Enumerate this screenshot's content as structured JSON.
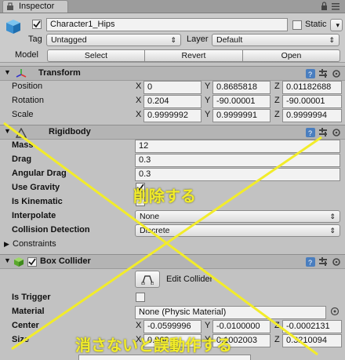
{
  "window": {
    "tab_label": "Inspector"
  },
  "header": {
    "object_name": "Character1_Hips",
    "static_label": "Static",
    "tag_label": "Tag",
    "tag_value": "Untagged",
    "layer_label": "Layer",
    "layer_value": "Default",
    "model_label": "Model",
    "model_buttons": [
      "Select",
      "Revert",
      "Open"
    ]
  },
  "transform": {
    "title": "Transform",
    "rows": [
      {
        "label": "Position",
        "x": "0",
        "y": "0.8685818",
        "z": "0.01182688"
      },
      {
        "label": "Rotation",
        "x": "0.204",
        "y": "-90.00001",
        "z": "-90.00001"
      },
      {
        "label": "Scale",
        "x": "0.9999992",
        "y": "0.9999991",
        "z": "0.9999994"
      }
    ],
    "axis": {
      "x": "X",
      "y": "Y",
      "z": "Z"
    }
  },
  "rigidbody": {
    "title": "Rigidbody",
    "mass_label": "Mass",
    "mass_value": "12",
    "drag_label": "Drag",
    "drag_value": "0.3",
    "angular_drag_label": "Angular Drag",
    "angular_drag_value": "0.3",
    "use_gravity_label": "Use Gravity",
    "is_kinematic_label": "Is Kinematic",
    "interpolate_label": "Interpolate",
    "interpolate_value": "None",
    "collision_label": "Collision Detection",
    "collision_value": "Discrete",
    "constraints_label": "Constraints"
  },
  "box_collider": {
    "title": "Box Collider",
    "edit_label": "Edit Collider",
    "is_trigger_label": "Is Trigger",
    "material_label": "Material",
    "material_value": "None (Physic Material)",
    "center_label": "Center",
    "center_x": "-0.0599996",
    "center_y": "-0.0100000",
    "center_z": "-0.0002131",
    "size_label": "Size",
    "size_x": "0.868",
    "size_y": "0.1002003",
    "size_z": "0.3210094"
  },
  "annotation": {
    "top_text": "削除する",
    "bottom_text": "消さないと誤動作する",
    "color": "#f2ec2a"
  }
}
